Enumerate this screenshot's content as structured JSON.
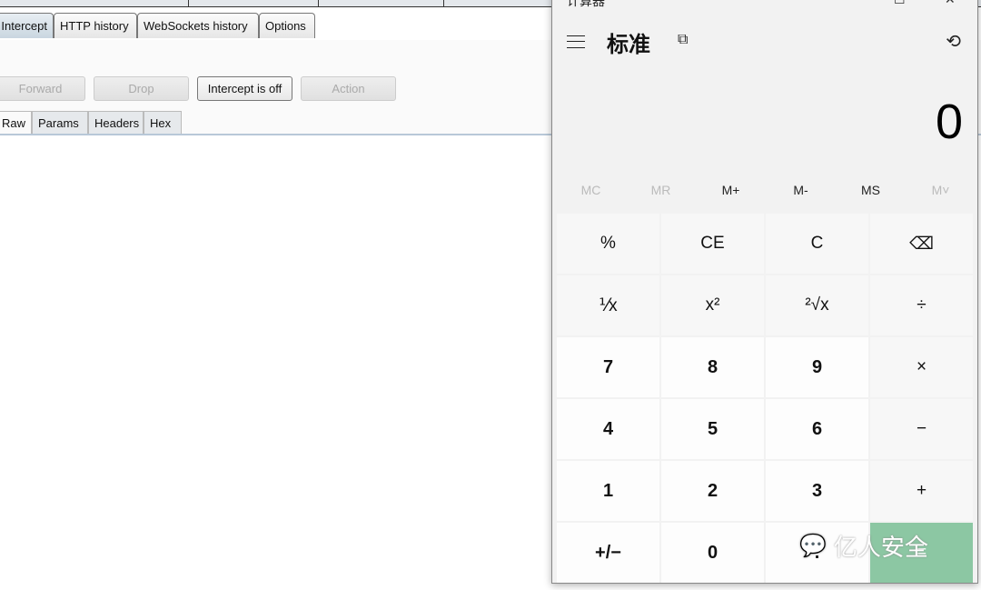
{
  "burp": {
    "tabs": [
      "Intercept",
      "HTTP history",
      "WebSockets history",
      "Options"
    ],
    "buttons": {
      "forward": "Forward",
      "drop": "Drop",
      "intercept": "Intercept is off",
      "action": "Action"
    },
    "message_tabs": [
      "Raw",
      "Params",
      "Headers",
      "Hex"
    ]
  },
  "calc": {
    "title": "计算器",
    "mode": "标准",
    "display": "0",
    "memory": [
      "MC",
      "MR",
      "M+",
      "M-",
      "MS",
      "M˅"
    ],
    "keys": [
      [
        "%",
        "CE",
        "C",
        "⌫"
      ],
      [
        "⅟x",
        "x²",
        "²√x",
        "÷"
      ],
      [
        "7",
        "8",
        "9",
        "×"
      ],
      [
        "4",
        "5",
        "6",
        "−"
      ],
      [
        "1",
        "2",
        "3",
        "+"
      ],
      [
        "+/−",
        "0",
        ".",
        "="
      ]
    ],
    "equals_color": "#8cc7a3"
  },
  "watermark": "亿人安全"
}
